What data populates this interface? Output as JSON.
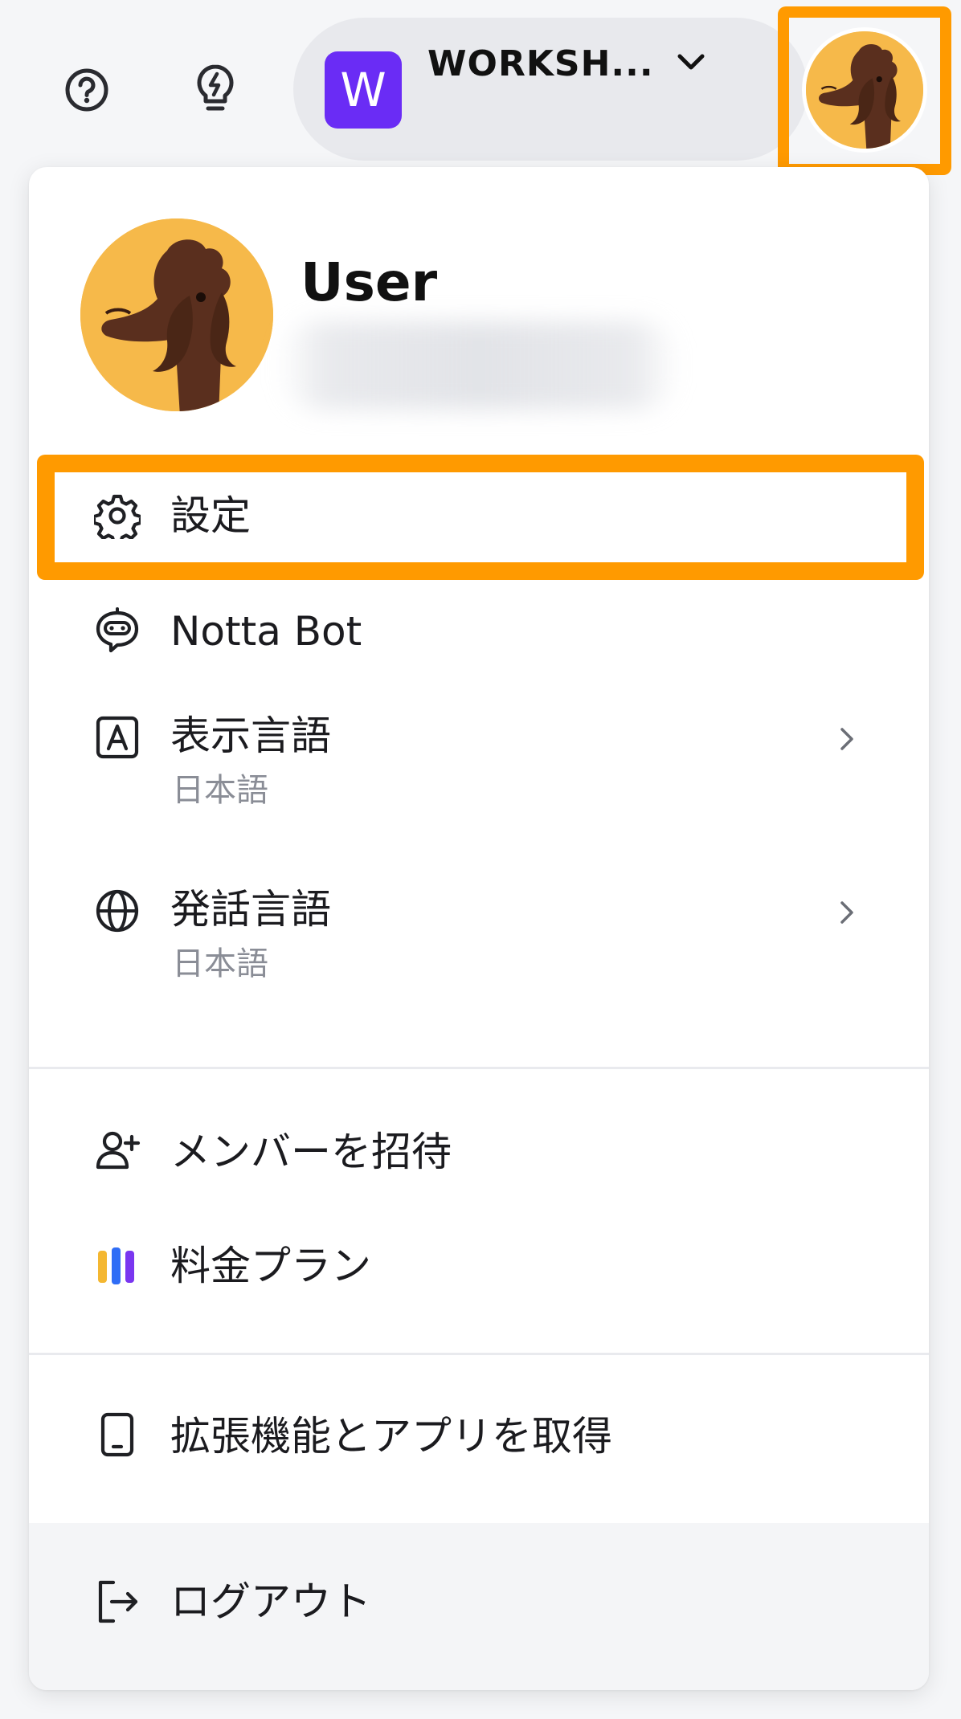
{
  "topbar": {
    "workspace_initial": "W",
    "workspace_name": "WORKSH...",
    "help_icon": "help-circle-icon",
    "tips_icon": "lightbulb-icon",
    "avatar_icon": "dog-avatar",
    "highlight_color": "#ff9a00",
    "workspace_badge_color": "#6a2cf5"
  },
  "menu": {
    "user_name": "User",
    "items": [
      {
        "label": "設定",
        "icon": "gear-icon"
      },
      {
        "label": "Notta Bot",
        "icon": "bot-icon"
      },
      {
        "label": "表示言語",
        "sublabel": "日本語",
        "icon": "letter-a-icon"
      },
      {
        "label": "発話言語",
        "sublabel": "日本語",
        "icon": "globe-icon"
      },
      {
        "label": "メンバーを招待",
        "icon": "add-user-icon"
      },
      {
        "label": "料金プラン",
        "icon": "plan-bars-icon"
      },
      {
        "label": "拡張機能とアプリを取得",
        "icon": "device-icon"
      },
      {
        "label": "ログアウト",
        "icon": "logout-icon"
      }
    ]
  }
}
